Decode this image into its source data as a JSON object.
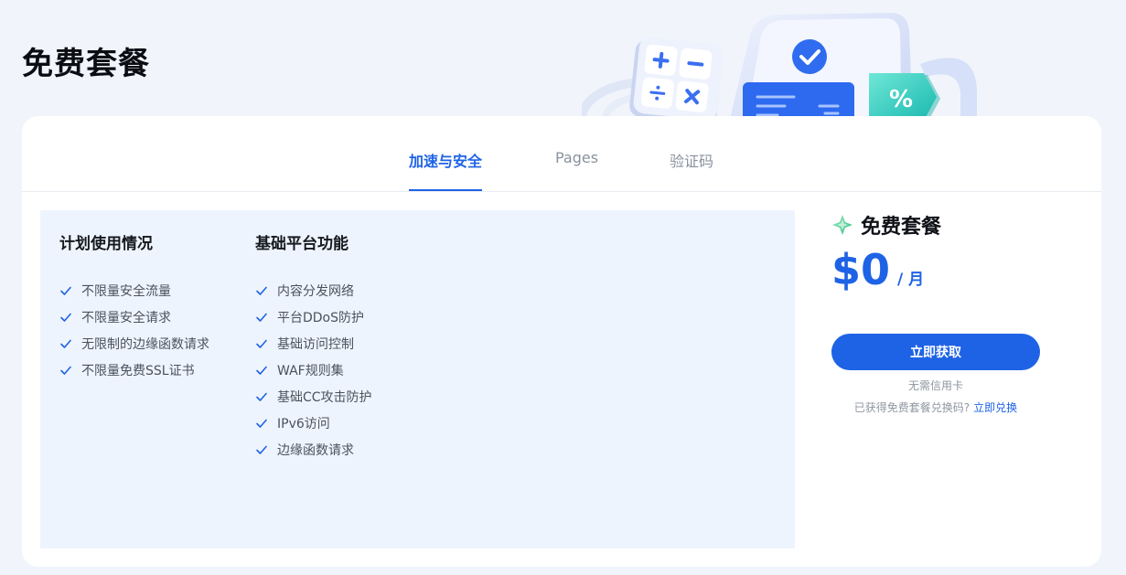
{
  "page": {
    "title": "免费套餐"
  },
  "tabs": [
    {
      "label": "加速与安全",
      "active": true
    },
    {
      "label": "Pages",
      "active": false
    },
    {
      "label": "验证码",
      "active": false
    }
  ],
  "usage": {
    "title": "计划使用情况",
    "items": [
      "不限量安全流量",
      "不限量安全请求",
      "无限制的边缘函数请求",
      "不限量免费SSL证书"
    ]
  },
  "platform": {
    "title": "基础平台功能",
    "items": [
      "内容分发网络",
      "平台DDoS防护",
      "基础访问控制",
      "WAF规则集",
      "基础CC攻击防护",
      "IPv6访问",
      "边缘函数请求"
    ]
  },
  "plan": {
    "name": "免费套餐",
    "price": "$0",
    "unit": "/ 月",
    "button": "立即获取",
    "note": "无需信用卡",
    "redeem_text": "已获得免费套餐兑换码?",
    "redeem_link": "立即兑换"
  },
  "colors": {
    "accent": "#1e63e6",
    "background": "#f1f5fb",
    "feature_panel": "#eef4fd"
  },
  "icons": {
    "check": "check-icon",
    "plan": "sparkle-icon"
  }
}
